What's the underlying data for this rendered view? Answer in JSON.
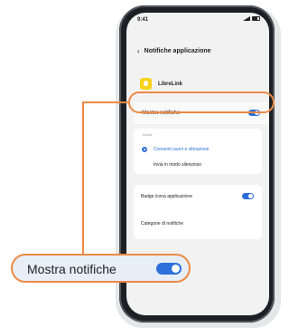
{
  "status_bar": {
    "time": "9:41"
  },
  "header": {
    "back_icon": "‹",
    "title": "Notifiche applicazione"
  },
  "app": {
    "name": "LibreLink",
    "icon_color": "#f7d417"
  },
  "settings": {
    "mostra_notifiche": {
      "label": "Mostra notifiche",
      "enabled": true
    },
    "section_label": "Avvisi",
    "options": [
      {
        "label": "Consenti suoni e vibrazione",
        "selected": true
      },
      {
        "label": "Invia in modo silenzioso",
        "selected": false
      }
    ],
    "badge": {
      "label": "Badge icona applicazione",
      "enabled": true
    },
    "categories": {
      "label": "Categorie di notifiche"
    }
  },
  "callout": {
    "label": "Mostra notifiche",
    "enabled": true
  },
  "colors": {
    "accent": "#2d6fd8",
    "highlight": "#ec8a45",
    "callout_bg": "#e7eef7"
  }
}
